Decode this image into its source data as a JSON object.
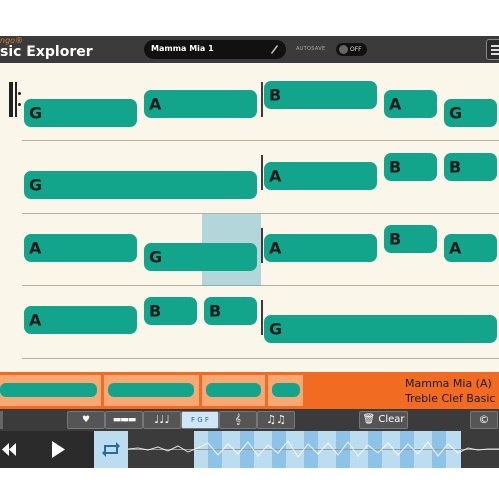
{
  "header": {
    "brand": "ngo®",
    "app_title": "sic Explorer",
    "song_name": "Mamma Mia 1",
    "autosave_label": "AUTOSAVE",
    "autosave_state": "OFF"
  },
  "staff": {
    "rows": [
      {
        "notes": [
          {
            "label": "G"
          },
          {
            "label": "A"
          },
          {
            "label": "B"
          },
          {
            "label": "A"
          },
          {
            "label": "G"
          }
        ]
      },
      {
        "notes": [
          {
            "label": "G"
          },
          {
            "label": "A"
          },
          {
            "label": "B"
          },
          {
            "label": "B"
          }
        ]
      },
      {
        "notes": [
          {
            "label": "A"
          },
          {
            "label": "G"
          },
          {
            "label": "A"
          },
          {
            "label": "B"
          },
          {
            "label": "A"
          }
        ]
      },
      {
        "notes": [
          {
            "label": "A"
          },
          {
            "label": "B"
          },
          {
            "label": "B"
          },
          {
            "label": "G"
          }
        ]
      }
    ]
  },
  "overview": {
    "title": "Mamma Mia (A)",
    "subtitle": "Treble Clef Basic"
  },
  "toolbar": {
    "clear_label": "Clear",
    "note_names_label": "F G F",
    "copyright_symbol": "©"
  },
  "colors": {
    "note": "#12a58c",
    "staff_bg": "#fbf6ea",
    "overview_bg": "#f26b22",
    "header_bg": "#3b3b3b",
    "selection": "#bcdcf0"
  },
  "icons": [
    "pencil-icon",
    "menu-icon",
    "heart-icon",
    "measure-icon",
    "quarter-notes-icon",
    "note-names-icon",
    "staff-view-icon",
    "staff-notes-icon",
    "trash-icon",
    "copyright-icon",
    "rewind-icon",
    "play-icon",
    "loop-icon"
  ]
}
